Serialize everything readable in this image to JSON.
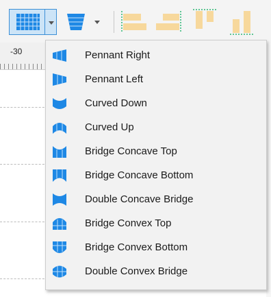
{
  "toolbar": {
    "tools": [
      {
        "icon": "grid-shape-icon",
        "active": true
      },
      {
        "icon": "pennant-shape-icon",
        "active": false
      },
      {
        "icon": "align-left-icon"
      },
      {
        "icon": "align-right-icon"
      },
      {
        "icon": "align-top-icon"
      },
      {
        "icon": "align-bottom-icon"
      }
    ]
  },
  "ruler": {
    "label": "-30"
  },
  "menu": {
    "items": [
      {
        "label": "Pennant Right",
        "icon": "pennant-right-icon"
      },
      {
        "label": "Pennant Left",
        "icon": "pennant-left-icon"
      },
      {
        "label": "Curved Down",
        "icon": "curved-down-icon"
      },
      {
        "label": "Curved Up",
        "icon": "curved-up-icon"
      },
      {
        "label": "Bridge Concave Top",
        "icon": "bridge-concave-top-icon"
      },
      {
        "label": "Bridge Concave Bottom",
        "icon": "bridge-concave-bottom-icon"
      },
      {
        "label": "Double Concave Bridge",
        "icon": "double-concave-bridge-icon"
      },
      {
        "label": "Bridge Convex Top",
        "icon": "bridge-convex-top-icon"
      },
      {
        "label": "Bridge Convex Bottom",
        "icon": "bridge-convex-bottom-icon"
      },
      {
        "label": "Double Convex Bridge",
        "icon": "double-convex-bridge-icon"
      }
    ]
  },
  "colors": {
    "accent": "#1e88e5",
    "accent_dark": "#1565c0",
    "align_fill": "#f7d89c",
    "align_guide": "#2bb673"
  }
}
